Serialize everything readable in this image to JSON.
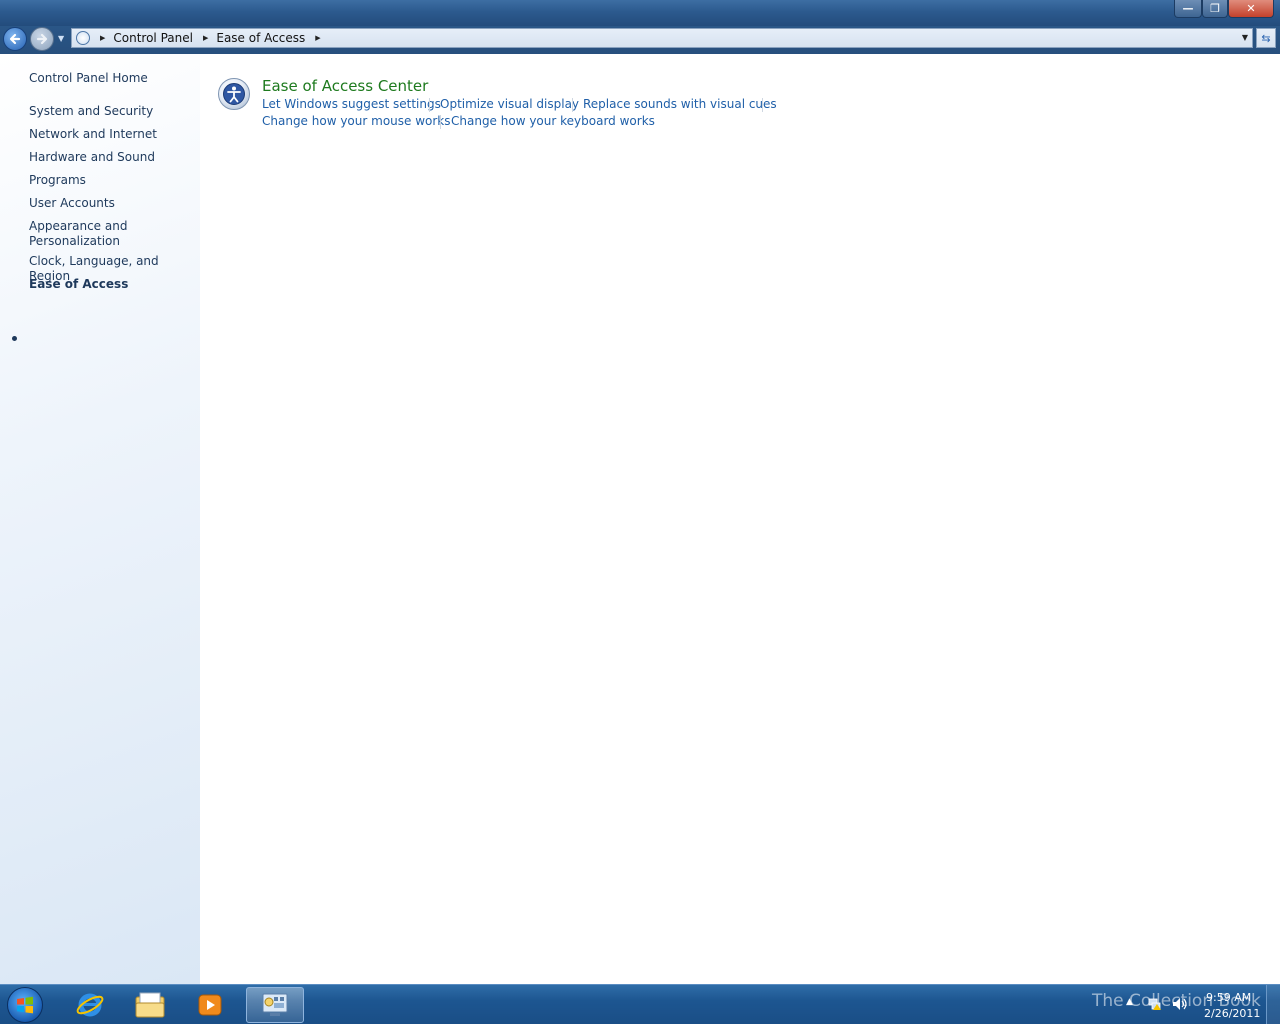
{
  "window": {
    "title_buttons": {
      "minimize_icon": "minimize-icon",
      "maximize_icon": "restore-icon",
      "close_icon": "close-icon"
    }
  },
  "navigation": {
    "breadcrumbs": [
      "Control Panel",
      "Ease of Access"
    ]
  },
  "sidebar": {
    "home": "Control Panel Home",
    "items": [
      {
        "label": "System and Security"
      },
      {
        "label": "Network and Internet"
      },
      {
        "label": "Hardware and Sound"
      },
      {
        "label": "Programs"
      },
      {
        "label": "User Accounts"
      },
      {
        "label": "Appearance and Personalization"
      },
      {
        "label": "Clock, Language, and Region"
      },
      {
        "label": "Ease of Access",
        "active": true
      }
    ]
  },
  "main": {
    "section_title": "Ease of Access Center",
    "tasks": [
      "Let Windows suggest settings",
      "Optimize visual display",
      "Replace sounds with visual cues",
      "Change how your mouse works",
      "Change how your keyboard works"
    ]
  },
  "taskbar": {
    "watermark": "The Collection Book",
    "clock_time": "9:59 AM",
    "clock_date": "2/26/2011",
    "pinned": [
      "start-orb-icon",
      "internet-explorer-icon",
      "windows-explorer-icon",
      "media-player-icon",
      "control-panel-icon"
    ]
  },
  "colors": {
    "link": "#1f5fa8",
    "section_title": "#1e7a1e",
    "sidebar_text": "#1e395b",
    "taskbar": "#1d5691"
  }
}
